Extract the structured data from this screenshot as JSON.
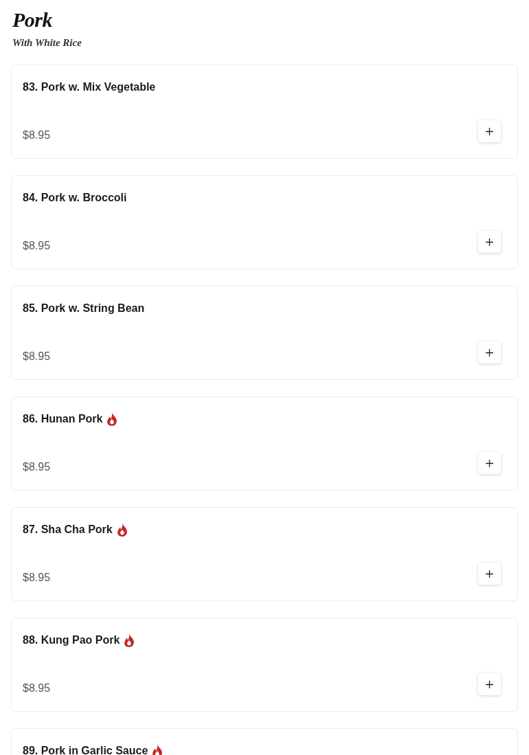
{
  "section": {
    "title": "Pork",
    "subtitle": "With White Rice"
  },
  "items": [
    {
      "name": "83. Pork w. Mix Vegetable",
      "spicy": false,
      "price": "$8.95"
    },
    {
      "name": "84. Pork w. Broccoli",
      "spicy": false,
      "price": "$8.95"
    },
    {
      "name": "85. Pork w. String Bean",
      "spicy": false,
      "price": "$8.95"
    },
    {
      "name": "86. Hunan Pork",
      "spicy": true,
      "price": "$8.95"
    },
    {
      "name": "87. Sha Cha Pork",
      "spicy": true,
      "price": "$8.95"
    },
    {
      "name": "88. Kung Pao Pork",
      "spicy": true,
      "price": "$8.95"
    },
    {
      "name": "89. Pork in Garlic Sauce",
      "spicy": true
    }
  ]
}
